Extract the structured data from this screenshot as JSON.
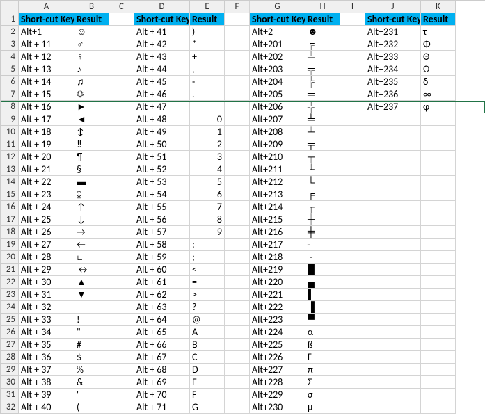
{
  "columns": [
    "A",
    "B",
    "C",
    "D",
    "E",
    "F",
    "G",
    "H",
    "I",
    "J",
    "K"
  ],
  "header_label_shortcut": "Short-cut Key",
  "header_label_result": "Result",
  "selected_row": 8,
  "groups": [
    {
      "col_key": "A",
      "col_res": "B",
      "rows": [
        {
          "k": "Alt+1",
          "r": "☺"
        },
        {
          "k": "Alt + 11",
          "r": "♂"
        },
        {
          "k": "Alt + 12",
          "r": "♀"
        },
        {
          "k": "Alt + 13",
          "r": "♪"
        },
        {
          "k": "Alt + 14",
          "r": "♫"
        },
        {
          "k": "Alt + 15",
          "r": "☼"
        },
        {
          "k": "Alt + 16",
          "r": "►"
        },
        {
          "k": "Alt + 17",
          "r": "◄"
        },
        {
          "k": "Alt + 18",
          "r": "↕"
        },
        {
          "k": "Alt + 19",
          "r": "‼"
        },
        {
          "k": "Alt + 20",
          "r": "¶"
        },
        {
          "k": "Alt + 21",
          "r": "§"
        },
        {
          "k": "Alt + 22",
          "r": "▬"
        },
        {
          "k": "Alt + 23",
          "r": "↨"
        },
        {
          "k": "Alt + 24",
          "r": "↑"
        },
        {
          "k": "Alt + 25",
          "r": "↓"
        },
        {
          "k": "Alt + 26",
          "r": "→"
        },
        {
          "k": "Alt + 27",
          "r": "←"
        },
        {
          "k": "Alt + 28",
          "r": "∟"
        },
        {
          "k": "Alt + 29",
          "r": "↔"
        },
        {
          "k": "Alt + 30",
          "r": "▲"
        },
        {
          "k": "Alt + 31",
          "r": "▼"
        },
        {
          "k": "Alt + 32",
          "r": ""
        },
        {
          "k": "Alt + 33",
          "r": "!"
        },
        {
          "k": "Alt + 34",
          "r": "\""
        },
        {
          "k": "Alt + 35",
          "r": "#"
        },
        {
          "k": "Alt + 36",
          "r": "$"
        },
        {
          "k": "Alt + 37",
          "r": "%"
        },
        {
          "k": "Alt + 38",
          "r": "&"
        },
        {
          "k": "Alt + 39",
          "r": "'"
        },
        {
          "k": "Alt + 40",
          "r": "("
        }
      ]
    },
    {
      "col_key": "D",
      "col_res": "E",
      "rows": [
        {
          "k": "Alt + 41",
          "r": ")"
        },
        {
          "k": "Alt + 42",
          "r": "*"
        },
        {
          "k": "Alt + 43",
          "r": "+"
        },
        {
          "k": "Alt + 44",
          "r": ","
        },
        {
          "k": "Alt + 45",
          "r": "-"
        },
        {
          "k": "Alt + 46",
          "r": "."
        },
        {
          "k": "Alt + 47",
          "r": ""
        },
        {
          "k": "Alt + 48",
          "r": "0",
          "num": true
        },
        {
          "k": "Alt + 49",
          "r": "1",
          "num": true
        },
        {
          "k": "Alt + 50",
          "r": "2",
          "num": true
        },
        {
          "k": "Alt + 51",
          "r": "3",
          "num": true
        },
        {
          "k": "Alt + 52",
          "r": "4",
          "num": true
        },
        {
          "k": "Alt + 53",
          "r": "5",
          "num": true
        },
        {
          "k": "Alt + 54",
          "r": "6",
          "num": true
        },
        {
          "k": "Alt + 55",
          "r": "7",
          "num": true
        },
        {
          "k": "Alt + 56",
          "r": "8",
          "num": true
        },
        {
          "k": "Alt + 57",
          "r": "9",
          "num": true
        },
        {
          "k": "Alt + 58",
          "r": ":"
        },
        {
          "k": "Alt + 59",
          "r": ";"
        },
        {
          "k": "Alt + 60",
          "r": "<"
        },
        {
          "k": "Alt + 61",
          "r": "="
        },
        {
          "k": "Alt + 62",
          "r": ">"
        },
        {
          "k": "Alt + 63",
          "r": "?"
        },
        {
          "k": "Alt + 64",
          "r": "@"
        },
        {
          "k": "Alt + 65",
          "r": "A"
        },
        {
          "k": "Alt + 66",
          "r": "B"
        },
        {
          "k": "Alt + 67",
          "r": "C"
        },
        {
          "k": "Alt + 68",
          "r": "D"
        },
        {
          "k": "Alt + 69",
          "r": "E"
        },
        {
          "k": "Alt + 70",
          "r": "F"
        },
        {
          "k": "Alt + 71",
          "r": "G"
        }
      ]
    },
    {
      "col_key": "G",
      "col_res": "H",
      "rows": [
        {
          "k": "Alt+2",
          "r": "☻"
        },
        {
          "k": "Alt+201",
          "r": "╔"
        },
        {
          "k": "Alt+202",
          "r": "╩"
        },
        {
          "k": "Alt+203",
          "r": "╦"
        },
        {
          "k": "Alt+204",
          "r": "╠"
        },
        {
          "k": "Alt+205",
          "r": "═"
        },
        {
          "k": "Alt+206",
          "r": "╬"
        },
        {
          "k": "Alt+207",
          "r": "╧"
        },
        {
          "k": "Alt+208",
          "r": "╨"
        },
        {
          "k": "Alt+209",
          "r": "╤"
        },
        {
          "k": "Alt+210",
          "r": "╥"
        },
        {
          "k": "Alt+211",
          "r": "╙"
        },
        {
          "k": "Alt+212",
          "r": "╘"
        },
        {
          "k": "Alt+213",
          "r": "╒"
        },
        {
          "k": "Alt+214",
          "r": "╓"
        },
        {
          "k": "Alt+215",
          "r": "╫"
        },
        {
          "k": "Alt+216",
          "r": "╪"
        },
        {
          "k": "Alt+217",
          "r": "┘"
        },
        {
          "k": "Alt+218",
          "r": "┌"
        },
        {
          "k": "Alt+219",
          "r": "█"
        },
        {
          "k": "Alt+220",
          "r": "▄"
        },
        {
          "k": "Alt+221",
          "r": "▌"
        },
        {
          "k": "Alt+222",
          "r": "▐"
        },
        {
          "k": "Alt+223",
          "r": "▀"
        },
        {
          "k": "Alt+224",
          "r": "α"
        },
        {
          "k": "Alt+225",
          "r": "ß"
        },
        {
          "k": "Alt+226",
          "r": "Γ"
        },
        {
          "k": "Alt+227",
          "r": "π"
        },
        {
          "k": "Alt+228",
          "r": "Σ"
        },
        {
          "k": "Alt+229",
          "r": "σ"
        },
        {
          "k": "Alt+230",
          "r": "µ"
        }
      ]
    },
    {
      "col_key": "J",
      "col_res": "K",
      "rows": [
        {
          "k": "Alt+231",
          "r": "τ"
        },
        {
          "k": "Alt+232",
          "r": "Φ"
        },
        {
          "k": "Alt+233",
          "r": "Θ"
        },
        {
          "k": "Alt+234",
          "r": "Ω"
        },
        {
          "k": "Alt+235",
          "r": "δ"
        },
        {
          "k": "Alt+236",
          "r": "∞"
        },
        {
          "k": "Alt+237",
          "r": "φ"
        }
      ]
    }
  ]
}
